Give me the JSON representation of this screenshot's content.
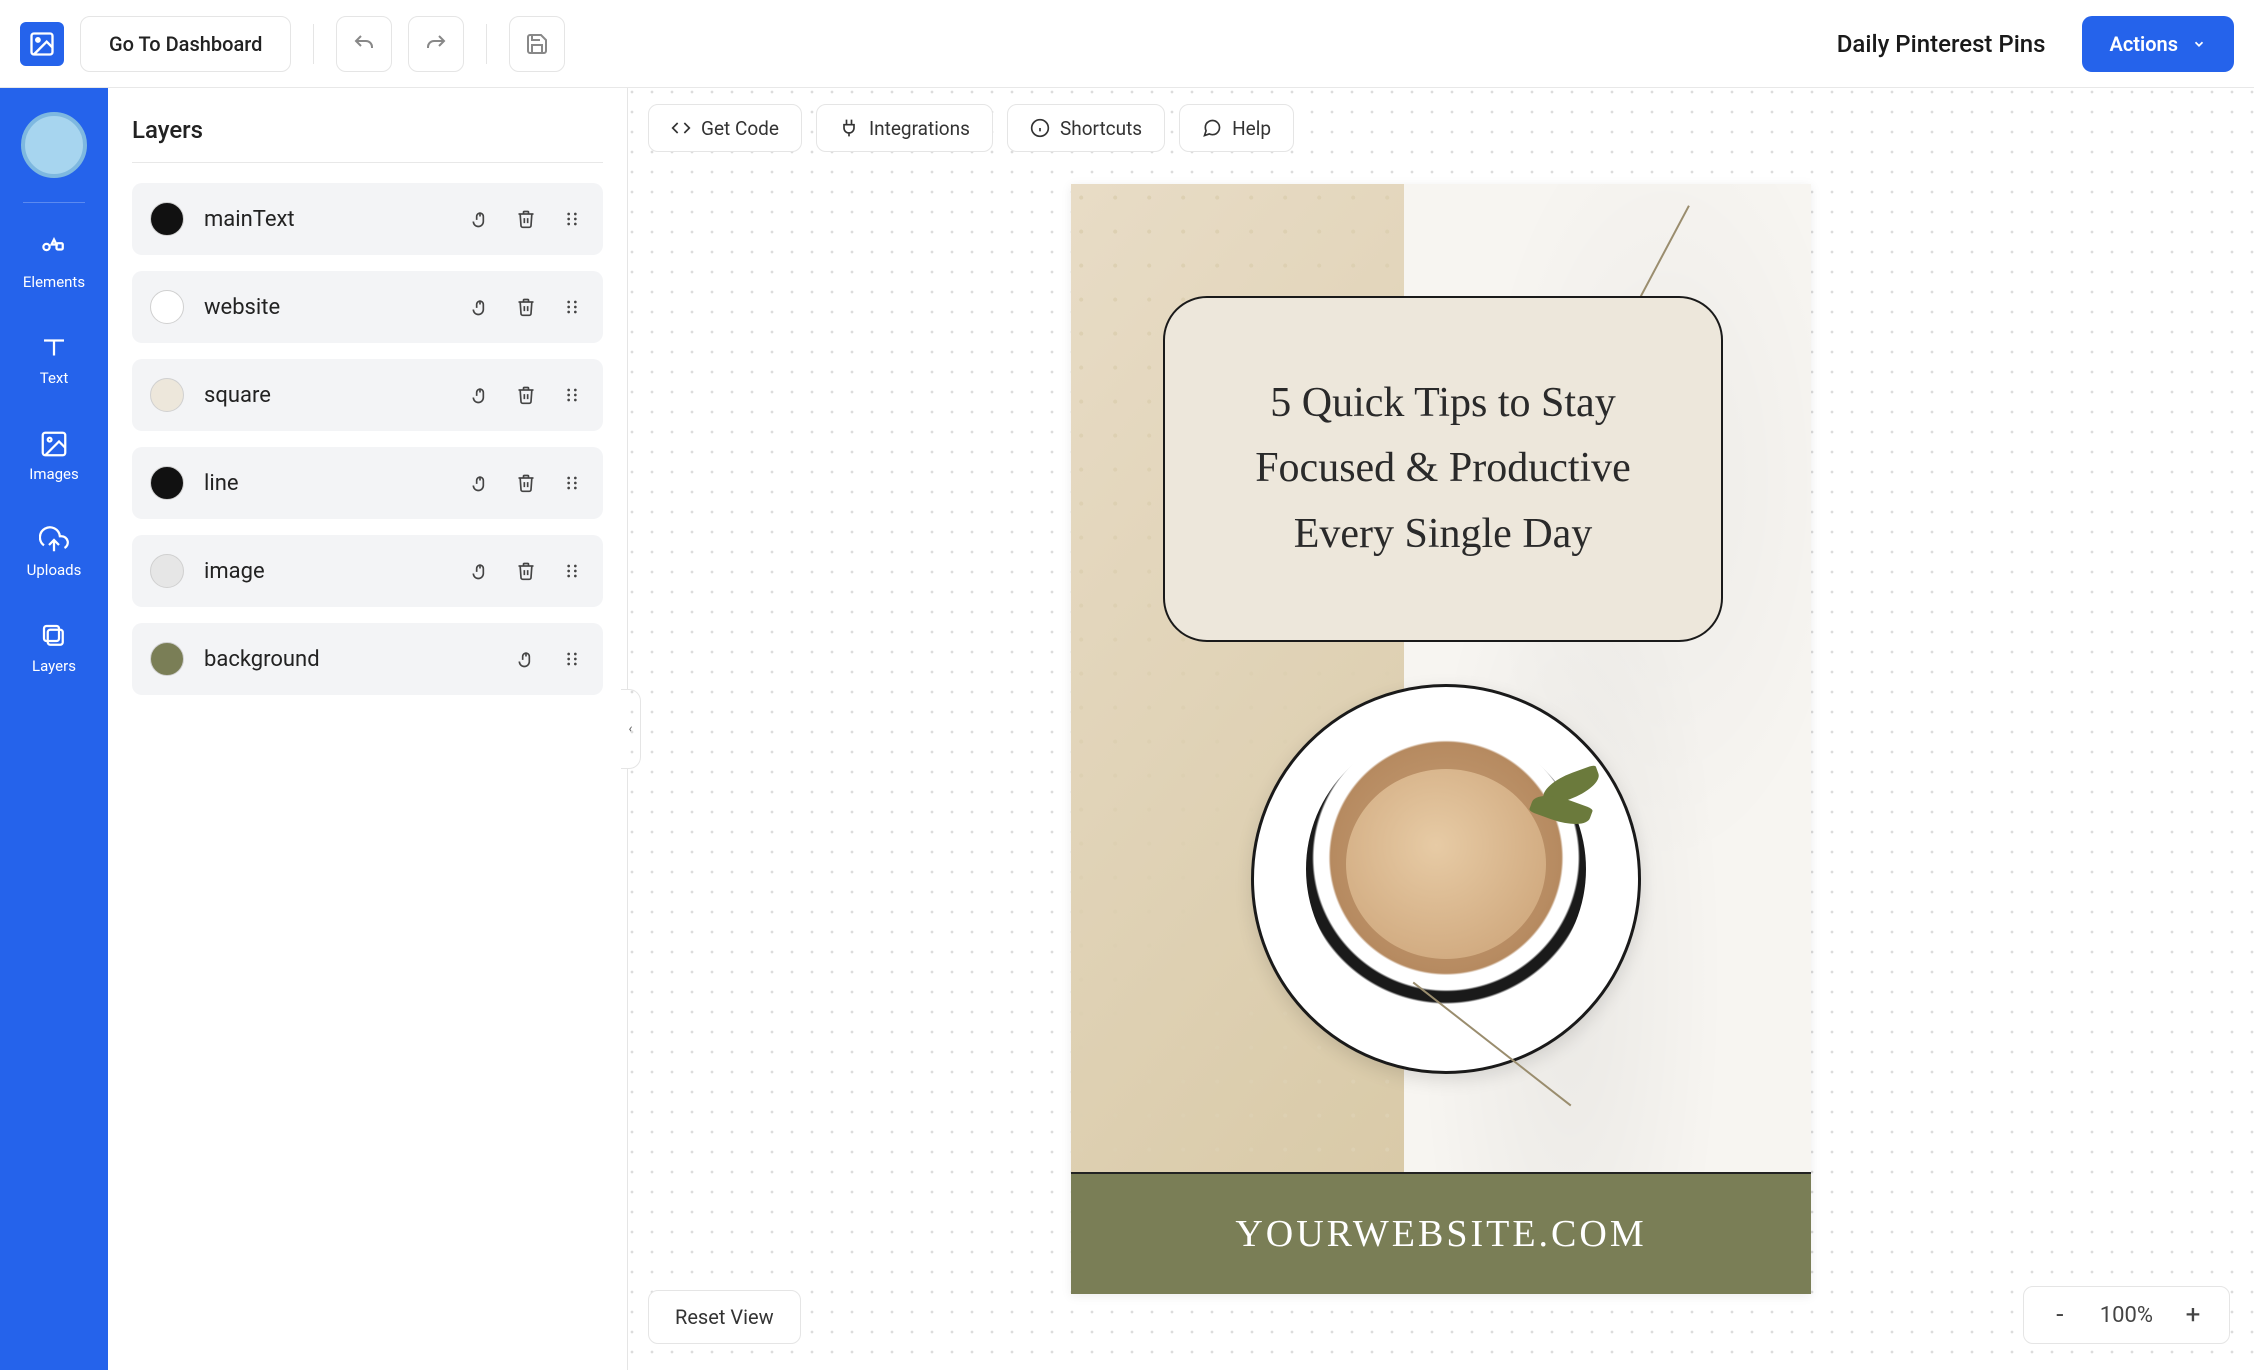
{
  "header": {
    "dashboard_btn": "Go To Dashboard",
    "project_title": "Daily Pinterest Pins",
    "actions_btn": "Actions"
  },
  "rail": {
    "items": [
      {
        "label": "Elements"
      },
      {
        "label": "Text"
      },
      {
        "label": "Images"
      },
      {
        "label": "Uploads"
      },
      {
        "label": "Layers"
      }
    ]
  },
  "layers": {
    "title": "Layers",
    "rows": [
      {
        "name": "mainText",
        "swatch": "#111111",
        "deletable": true
      },
      {
        "name": "website",
        "swatch": "#ffffff",
        "deletable": true
      },
      {
        "name": "square",
        "swatch": "#ede7db",
        "deletable": true
      },
      {
        "name": "line",
        "swatch": "#111111",
        "deletable": true
      },
      {
        "name": "image",
        "swatch": "#e6e6e6",
        "deletable": true
      },
      {
        "name": "background",
        "swatch": "#7a7e56",
        "deletable": false
      }
    ]
  },
  "canvas_toolbar": {
    "get_code": "Get Code",
    "integrations": "Integrations",
    "shortcuts": "Shortcuts",
    "help": "Help"
  },
  "pin": {
    "headline": "5 Quick Tips to Stay Focused & Productive Every Single Day",
    "website": "YOURWEBSITE.COM"
  },
  "footer": {
    "reset_view": "Reset View",
    "zoom": "100%"
  }
}
